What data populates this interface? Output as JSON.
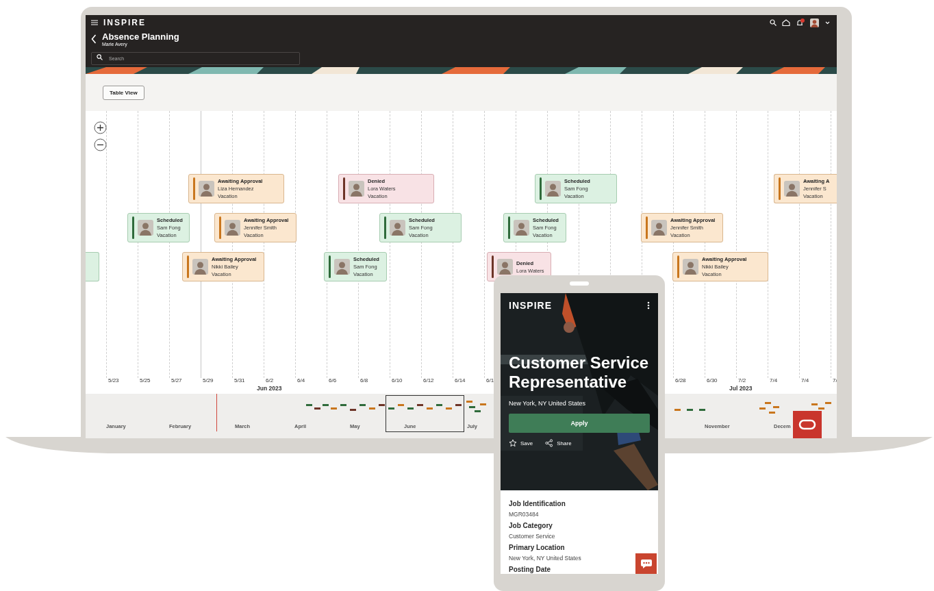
{
  "laptop": {
    "header": {
      "logo": "INSPIRE",
      "title": "Absence Planning",
      "subtitle": "Marie Avery",
      "search": {
        "placeholder": "Search"
      }
    },
    "toolbar": {
      "button": "Table View"
    },
    "timeline": {
      "cards": [
        {
          "kind": "awaiting",
          "title": "Awaiting Approval",
          "name": "Liza Hernandez",
          "type": "Vacation"
        },
        {
          "kind": "denied",
          "title": "Denied",
          "name": "Lora Waters",
          "type": "Vacation"
        },
        {
          "kind": "scheduled",
          "title": "Scheduled",
          "name": "Sam Fong",
          "type": "Vacation"
        },
        {
          "kind": "awaiting",
          "title": "Awaiting A",
          "name": "Jennifer S",
          "type": "Vacation"
        },
        {
          "kind": "scheduled",
          "title": "Scheduled",
          "name": "Sam Fong",
          "type": "Vacation"
        },
        {
          "kind": "awaiting",
          "title": "Awaiting Approval",
          "name": "Jennifer Smith",
          "type": "Vacation"
        },
        {
          "kind": "scheduled",
          "title": "Scheduled",
          "name": "Sam Fong",
          "type": "Vacation"
        },
        {
          "kind": "scheduled",
          "title": "Scheduled",
          "name": "Sam Fong",
          "type": "Vacation"
        },
        {
          "kind": "awaiting",
          "title": "Awaiting Approval",
          "name": "Jennifer Smith",
          "type": "Vacation"
        },
        {
          "kind": "scheduled"
        },
        {
          "kind": "awaiting",
          "title": "Awaiting Approval",
          "name": "Nikki Bailey",
          "type": "Vacation"
        },
        {
          "kind": "scheduled",
          "title": "Scheduled",
          "name": "Sam Fong",
          "type": "Vacation"
        },
        {
          "kind": "denied",
          "title": "Denied",
          "name": "Lora Waters"
        },
        {
          "kind": "awaiting",
          "title": "Awaiting Approval",
          "name": "Nikki Bailey",
          "type": "Vacation"
        }
      ],
      "dates": [
        "5/23",
        "5/25",
        "5/27",
        "5/29",
        "5/31",
        "6/2",
        "6/4",
        "6/6",
        "6/8",
        "6/10",
        "6/12",
        "6/14",
        "6/1",
        "6/28",
        "6/30",
        "7/2",
        "7/4",
        "7/4",
        "7/"
      ],
      "months": [
        "Jun 2023",
        "Jul 2023"
      ]
    },
    "overview": {
      "months": [
        "January",
        "February",
        "March",
        "April",
        "May",
        "June",
        "July",
        "November",
        "Decem"
      ]
    }
  },
  "phone": {
    "logo": "INSPIRE",
    "job_title": "Customer Service Representative",
    "location": "New York, NY United States",
    "apply_button": "Apply",
    "save": "Save",
    "share": "Share",
    "details": [
      {
        "label": "Job Identification",
        "value": "MGR03484"
      },
      {
        "label": "Job Category",
        "value": "Customer Service"
      },
      {
        "label": "Primary Location",
        "value": "New York, NY United States"
      },
      {
        "label": "Posting Date"
      }
    ]
  }
}
